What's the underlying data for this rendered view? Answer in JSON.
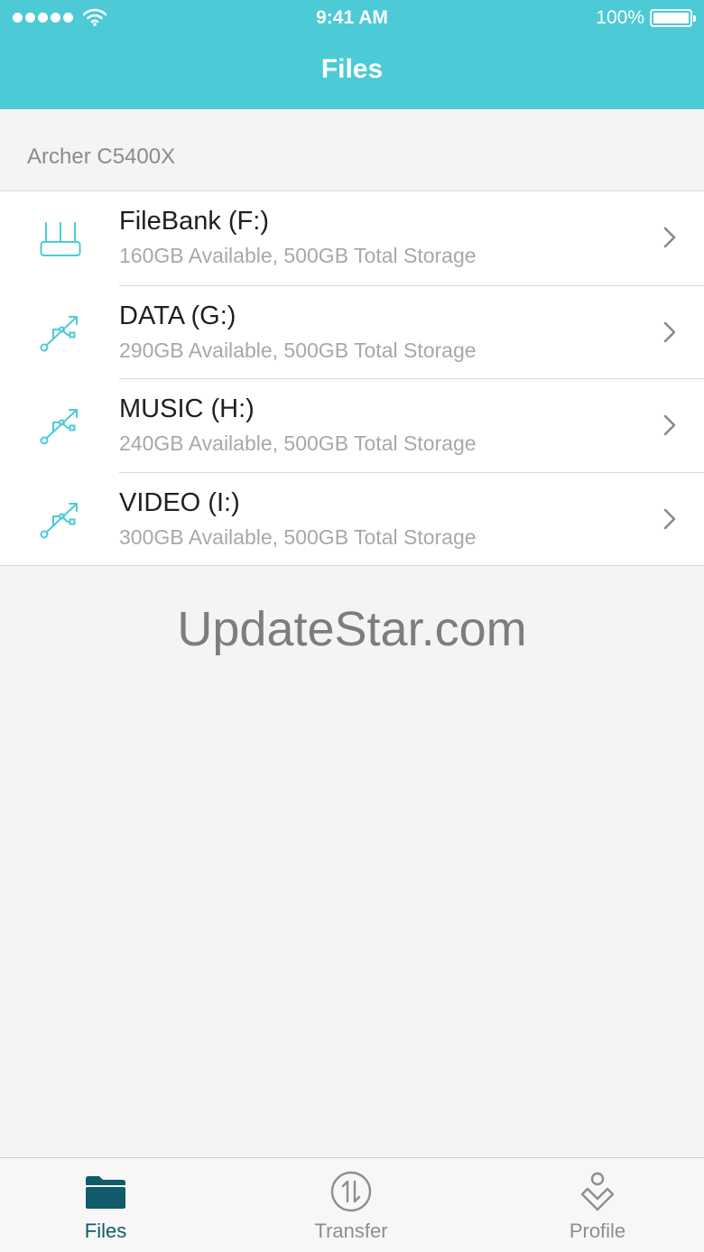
{
  "status_bar": {
    "time": "9:41 AM",
    "battery_percent": "100%",
    "battery_level": 1.0,
    "signal_bars": 5
  },
  "nav": {
    "title": "Files"
  },
  "device": {
    "name": "Archer C5400X"
  },
  "drives": [
    {
      "name": "FileBank (F:)",
      "storage": "160GB Available, 500GB Total Storage",
      "icon": "router-icon"
    },
    {
      "name": "DATA (G:)",
      "storage": "290GB Available, 500GB Total Storage",
      "icon": "usb-icon"
    },
    {
      "name": "MUSIC (H:)",
      "storage": "240GB Available, 500GB Total Storage",
      "icon": "usb-icon"
    },
    {
      "name": "VIDEO (I:)",
      "storage": "300GB Available, 500GB Total Storage",
      "icon": "usb-icon"
    }
  ],
  "watermark": "UpdateStar.com",
  "tabs": [
    {
      "label": "Files",
      "icon": "folder-icon",
      "active": true
    },
    {
      "label": "Transfer",
      "icon": "transfer-icon",
      "active": false
    },
    {
      "label": "Profile",
      "icon": "profile-icon",
      "active": false
    }
  ],
  "colors": {
    "header": "#4ccad6",
    "accent_icon": "#4ccad6",
    "active_tab": "#0f5b6b",
    "inactive_tab": "#8e8e8e"
  }
}
